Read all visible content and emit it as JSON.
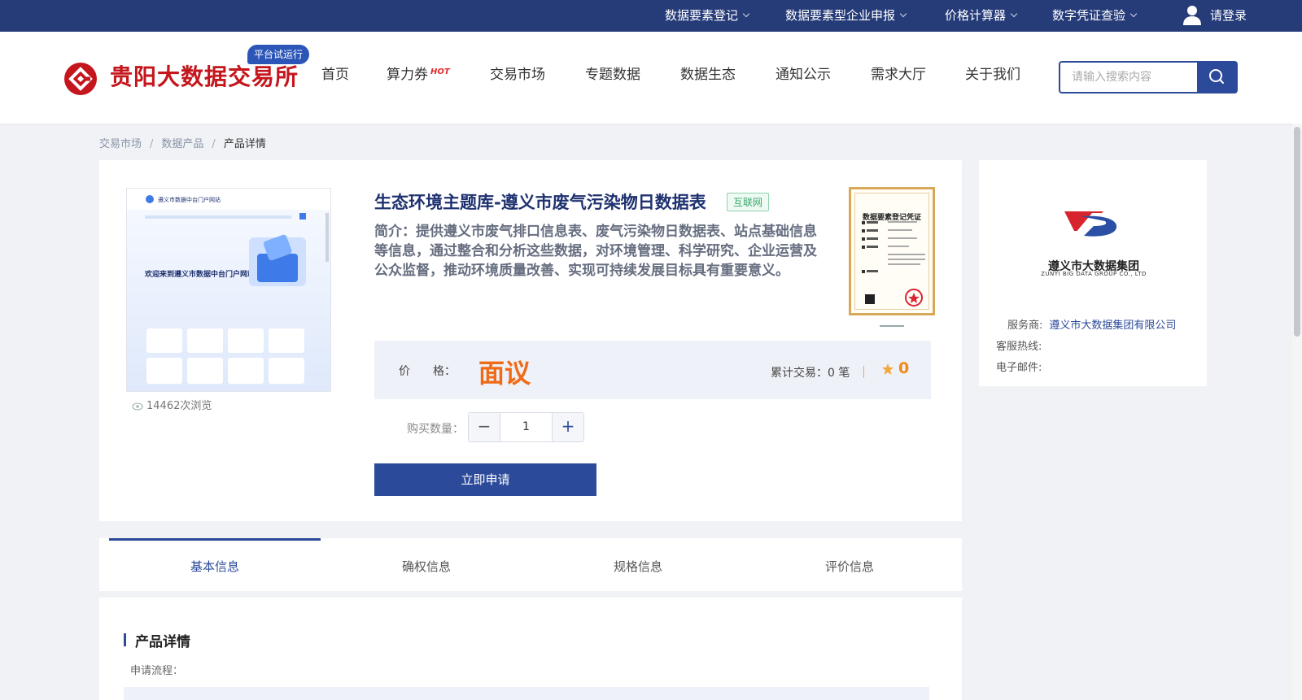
{
  "topbar": {
    "items": [
      {
        "label": "数据要素登记"
      },
      {
        "label": "数据要素型企业申报"
      },
      {
        "label": "价格计算器"
      },
      {
        "label": "数字凭证查验"
      }
    ],
    "login_label": "请登录"
  },
  "header": {
    "site_name": "贵阳大数据交易所",
    "trial_badge": "平台试运行",
    "nav": [
      "首页",
      "算力券",
      "交易市场",
      "专题数据",
      "数据生态",
      "通知公示",
      "需求大厅",
      "关于我们"
    ],
    "hot_badge": "HOT",
    "search_placeholder": "请输入搜索内容"
  },
  "breadcrumb": [
    "交易市场",
    "数据产品",
    "产品详情"
  ],
  "product": {
    "title": "生态环境主题库-遵义市废气污染物日数据表",
    "tag": "互联网",
    "intro": "简介：提供遵义市废气排口信息表、废气污染物日数据表、站点基础信息等信息，通过整合和分析这些数据，对环境管理、科学研究、企业运营及公众监督，推动环境质量改善、实现可持续发展目标具有重要意义。",
    "views": "14462次浏览",
    "thumb_banner": "欢迎来到遵义市数据中台门户网站",
    "thumb_header": "遵义市数据中台门户网站",
    "cert_title": "数据要素登记凭证",
    "price_label": "价　　格：",
    "price_value": "面议",
    "trade_count": "累计交易：0 笔",
    "rating": "0",
    "qty_label": "购买数量：",
    "qty_value": "1",
    "apply_label": "立即申请"
  },
  "provider": {
    "logo_name_cn": "遵义市大数据集团",
    "logo_name_en": "ZUNYI BIG DATA GROUP CO., LTD",
    "service_label": "服务商:",
    "service_value": "遵义市大数据集团有限公司",
    "hotline_label": "客服热线:",
    "email_label": "电子邮件:"
  },
  "tabs": [
    "基本信息",
    "确权信息",
    "规格信息",
    "评价信息"
  ],
  "detail": {
    "title": "产品详情",
    "apply_flow": "申请流程："
  },
  "colors": {
    "primary": "#2b4a9a",
    "topbar": "#263c79",
    "price": "#ef6b17",
    "logo_red": "#c4161c"
  }
}
